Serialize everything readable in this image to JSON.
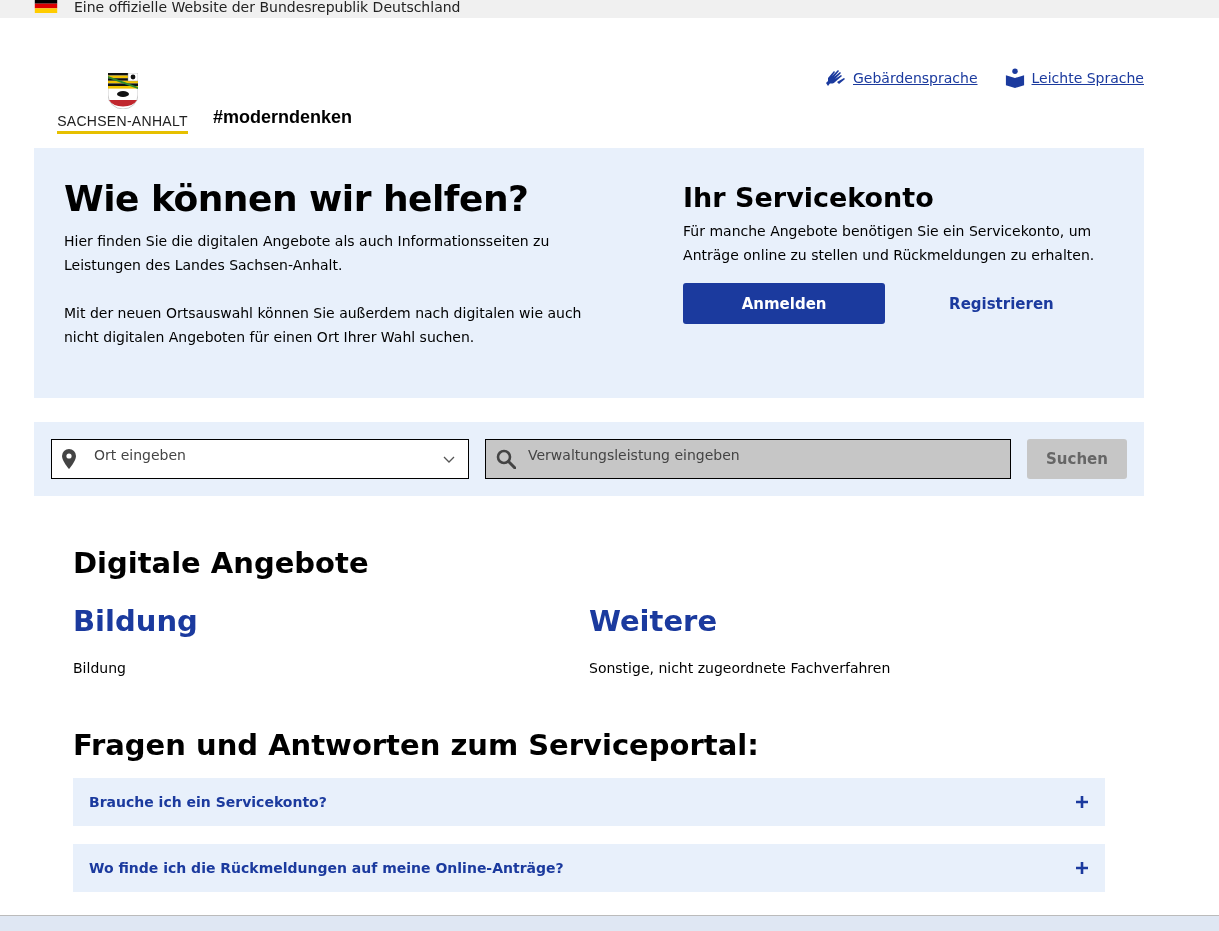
{
  "official_banner": {
    "text": "Eine offizielle Website der Bundesrepublik Deutschland"
  },
  "header": {
    "logo_text": "SACHSEN-ANHALT",
    "slogan": "#moderndenken",
    "links": [
      {
        "kind": "sign",
        "label": "Gebärdensprache"
      },
      {
        "kind": "easy",
        "label": "Leichte Sprache"
      }
    ]
  },
  "hero": {
    "title": "Wie können wir helfen?",
    "paragraphs": [
      "Hier finden Sie die digitalen Angebote als auch Informationsseiten zu Leistungen des Landes Sachsen-Anhalt.",
      "Mit der neuen Ortsauswahl können Sie außerdem nach digitalen wie auch nicht digitalen Angeboten für einen Ort Ihrer Wahl suchen."
    ],
    "account": {
      "title": "Ihr Servicekonto",
      "text": "Für manche Angebote benötigen Sie ein Servicekonto, um Anträge online zu stellen und Rückmeldungen zu erhalten.",
      "login": "Anmelden",
      "register": "Registrieren"
    }
  },
  "search": {
    "location": {
      "placeholder": "Ort eingeben"
    },
    "service": {
      "placeholder": "Verwaltungsleistung eingeben",
      "disabled": true
    },
    "button": {
      "label": "Suchen",
      "disabled": true
    }
  },
  "digital_offers": {
    "title": "Digitale Angebote",
    "categories": [
      {
        "title": "Bildung",
        "description": "Bildung"
      },
      {
        "title": "Weitere",
        "description": "Sonstige, nicht zugeordnete Fachverfahren"
      }
    ]
  },
  "faq": {
    "title": "Fragen und Antworten zum Serviceportal:",
    "items": [
      {
        "question": "Brauche ich ein Servicekonto?",
        "expanded": false
      },
      {
        "question": "Wo finde ich die Rückmeldungen auf meine Online-Anträge?",
        "expanded": false
      }
    ]
  }
}
